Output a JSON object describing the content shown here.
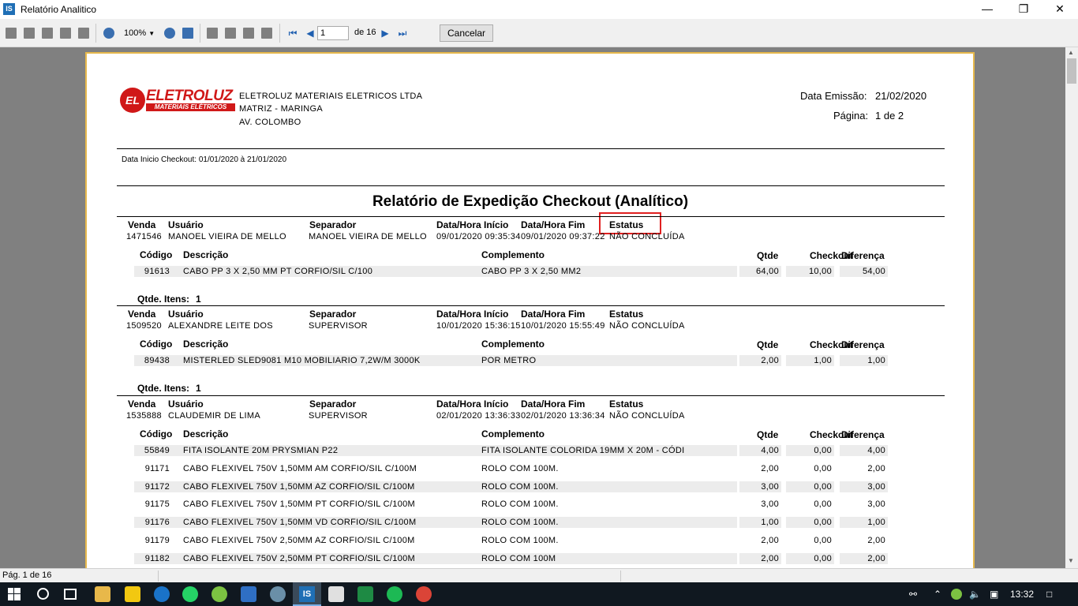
{
  "window": {
    "title": "Relatório Analitico",
    "icon_text": "IS"
  },
  "toolbar": {
    "zoom": "100%",
    "page_input": "1",
    "page_of": "de 16",
    "cancel_label": "Cancelar"
  },
  "report": {
    "company": {
      "logo_brand": "ELETROLUZ",
      "logo_sub": "MATERIAIS ELÉTRICOS",
      "logo_mark": "EL",
      "name": "ELETROLUZ MATERIAIS ELETRICOS LTDA",
      "branch": "MATRIZ - MARINGA",
      "address": "AV. COLOMBO"
    },
    "emission_label": "Data Emissão:",
    "emission_date": "21/02/2020",
    "page_label": "Página:",
    "page_value": "1 de 2",
    "date_range": "Data Inicio Checkout: 01/01/2020 à 21/01/2020",
    "title": "Relatório de Expedição Checkout (Analítico)",
    "labels": {
      "venda": "Venda",
      "usuario": "Usuário",
      "separador": "Separador",
      "inicio": "Data/Hora Início",
      "fim": "Data/Hora Fim",
      "estatus": "Estatus",
      "codigo": "Código",
      "descricao": "Descrição",
      "complemento": "Complemento",
      "qtde": "Qtde",
      "checkout": "Checkout",
      "diferenca": "Diferença",
      "qtde_itens": "Qtde. Itens:"
    },
    "orders": [
      {
        "venda": "1471546",
        "usuario": "MANOEL VIEIRA DE MELLO",
        "separador": "MANOEL VIEIRA DE MELLO",
        "inicio": "09/01/2020 09:35:34",
        "fim": "09/01/2020 09:37:22",
        "estatus": "NÃO CONCLUÍDA",
        "qtde_itens": "1",
        "items": [
          {
            "codigo": "91613",
            "descricao": "CABO PP 3 X  2,50 MM PT CORFIO/SIL C/100",
            "complemento": "CABO PP 3 X  2,50 MM2",
            "qtde": "64,00",
            "checkout": "10,00",
            "diferenca": "54,00"
          }
        ]
      },
      {
        "venda": "1509520",
        "usuario": "ALEXANDRE LEITE DOS",
        "separador": "SUPERVISOR",
        "inicio": "10/01/2020 15:36:15",
        "fim": "10/01/2020 15:55:49",
        "estatus": "NÃO CONCLUÍDA",
        "qtde_itens": "1",
        "items": [
          {
            "codigo": "89438",
            "descricao": "MISTERLED SLED9081 M10 MOBILIARIO  7,2W/M 3000K",
            "complemento": "POR METRO",
            "qtde": "2,00",
            "checkout": "1,00",
            "diferenca": "1,00"
          }
        ]
      },
      {
        "venda": "1535888",
        "usuario": "CLAUDEMIR DE LIMA",
        "separador": "SUPERVISOR",
        "inicio": "02/01/2020 13:36:33",
        "fim": "02/01/2020 13:36:34",
        "estatus": "NÃO CONCLUÍDA",
        "items": [
          {
            "codigo": "55849",
            "descricao": "FITA ISOLANTE 20M PRYSMIAN P22",
            "complemento": "FITA ISOLANTE COLORIDA 19MM X 20M - CÓDI",
            "qtde": "4,00",
            "checkout": "0,00",
            "diferenca": "4,00"
          },
          {
            "codigo": "91171",
            "descricao": "CABO FLEXIVEL 750V  1,50MM AM CORFIO/SIL C/100M",
            "complemento": "ROLO COM 100M.",
            "qtde": "2,00",
            "checkout": "0,00",
            "diferenca": "2,00"
          },
          {
            "codigo": "91172",
            "descricao": "CABO FLEXIVEL 750V  1,50MM AZ CORFIO/SIL C/100M",
            "complemento": "ROLO COM 100M.",
            "qtde": "3,00",
            "checkout": "0,00",
            "diferenca": "3,00"
          },
          {
            "codigo": "91175",
            "descricao": "CABO FLEXIVEL 750V  1,50MM PT CORFIO/SIL C/100M",
            "complemento": "ROLO COM 100M.",
            "qtde": "3,00",
            "checkout": "0,00",
            "diferenca": "3,00"
          },
          {
            "codigo": "91176",
            "descricao": "CABO FLEXIVEL 750V  1,50MM VD CORFIO/SIL C/100M",
            "complemento": "ROLO COM 100M.",
            "qtde": "1,00",
            "checkout": "0,00",
            "diferenca": "1,00"
          },
          {
            "codigo": "91179",
            "descricao": "CABO FLEXIVEL 750V  2,50MM AZ CORFIO/SIL C/100M",
            "complemento": "ROLO COM 100M.",
            "qtde": "2,00",
            "checkout": "0,00",
            "diferenca": "2,00"
          },
          {
            "codigo": "91182",
            "descricao": "CABO FLEXIVEL 750V  2,50MM PT CORFIO/SIL C/100M",
            "complemento": "ROLO COM 100M",
            "qtde": "2,00",
            "checkout": "0,00",
            "diferenca": "2,00"
          }
        ]
      }
    ]
  },
  "status": {
    "page": "Pág. 1 de 16"
  },
  "taskbar": {
    "time": "13:32"
  }
}
